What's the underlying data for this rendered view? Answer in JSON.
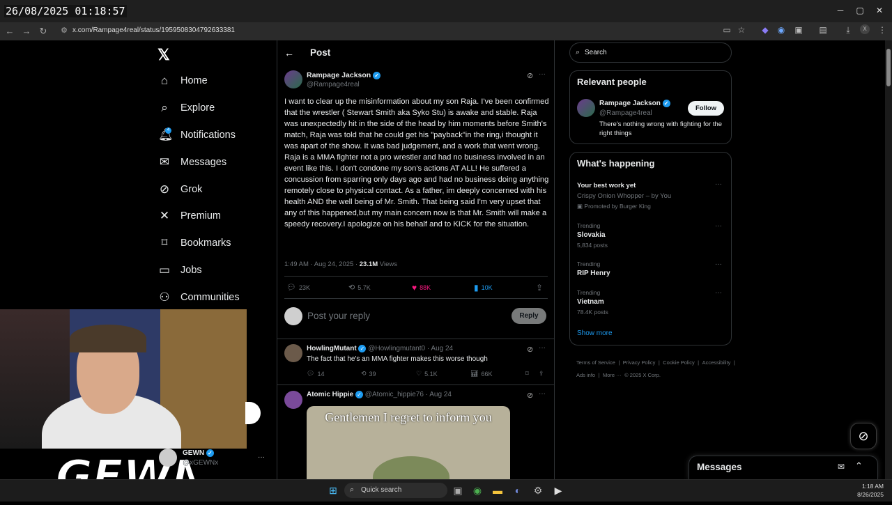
{
  "overlay": {
    "timestamp": "26/08/2025 01:18:57"
  },
  "browser": {
    "url": "x.com/Rampage4real/status/1959508304792633381",
    "window_controls": [
      "─",
      "▢",
      "✕"
    ],
    "profile_initial": "X"
  },
  "sidebar": {
    "logo": "𝕏",
    "items": [
      {
        "label": "Home",
        "icon": "home-icon"
      },
      {
        "label": "Explore",
        "icon": "search-icon"
      },
      {
        "label": "Notifications",
        "icon": "bell-icon"
      },
      {
        "label": "Messages",
        "icon": "envelope-icon"
      },
      {
        "label": "Grok",
        "icon": "grok-icon"
      },
      {
        "label": "Premium",
        "icon": "x-icon"
      },
      {
        "label": "Bookmarks",
        "icon": "bookmark-icon"
      },
      {
        "label": "Jobs",
        "icon": "briefcase-icon"
      },
      {
        "label": "Communities",
        "icon": "people-icon"
      }
    ],
    "notif_badge": "4",
    "account": {
      "name": "GEWN",
      "handle": "@xGEWNx",
      "more": "···"
    }
  },
  "post": {
    "header_title": "Post",
    "author_name": "Rampage Jackson",
    "author_handle": "@Rampage4real",
    "text": "I want to clear up the misinformation about my son Raja. I've been confirmed that the wrestler ( Stewart Smith aka Syko Stu) is awake and stable. Raja was unexpectedly hit in the side of the head by him moments before Smith's match, Raja was told that he could get his \"payback\"in the ring,i thought it was apart of the show. It was bad judgement, and a work that went wrong. Raja is a MMA fighter not a pro wrestler and had no business involved in an event like this. I don't condone my son's actions AT ALL! He suffered a concussion from sparring only days ago and had no business doing anything remotely close to physical contact. As a father, im deeply concerned with his health AND the well being of Mr. Smith. That being said I'm very upset that any of this happened,but my main concern now is that Mr. Smith will make a speedy recovery.I apologize on his behalf and to KICK for the situation.",
    "time": "1:49 AM · Aug 24, 2025 · ",
    "views_count": "23.1M",
    "views_label": " Views",
    "replies": "23K",
    "reposts": "5.7K",
    "likes": "88K",
    "bookmarks": "10K"
  },
  "compose": {
    "placeholder": "Post your reply",
    "button": "Reply"
  },
  "replies": [
    {
      "name": "HowlingMutant",
      "handle": "@Howlingmutant0",
      "date": "· Aug 24",
      "text": "The fact that he's an MMA fighter makes this worse though",
      "replies": "14",
      "reposts": "39",
      "likes": "5.1K",
      "views": "66K"
    },
    {
      "name": "Atomic Hippie",
      "handle": "@Atomic_hippie76",
      "date": "· Aug 24",
      "meme_caption": "Gentlemen I regret to inform you"
    }
  ],
  "right": {
    "search_placeholder": "Search",
    "relevant_title": "Relevant people",
    "person": {
      "name": "Rampage Jackson",
      "handle": "@Rampage4real",
      "bio": "There's nothing wrong with fighting for the right things",
      "follow": "Follow"
    },
    "happening_title": "What's happening",
    "promo": {
      "title": "Your best work yet",
      "subtitle": "Crispy Onion Whopper – by You",
      "promoted": "Promoted by Burger King"
    },
    "trends": [
      {
        "label": "Trending",
        "title": "Slovakia",
        "count": "5,834 posts"
      },
      {
        "label": "Trending",
        "title": "RIP Henry",
        "count": ""
      },
      {
        "label": "Trending",
        "title": "Vietnam",
        "count": "78.4K posts"
      }
    ],
    "show_more": "Show more",
    "footer": [
      "Terms of Service",
      "|",
      "Privacy Policy",
      "|",
      "Cookie Policy",
      "|",
      "Accessibility",
      "|",
      "Ads info",
      "|",
      "More ···",
      "© 2025 X Corp."
    ]
  },
  "messages_drawer": {
    "title": "Messages"
  },
  "taskbar": {
    "search": "Quick search",
    "time": "1:18 AM",
    "date": "8/26/2025"
  },
  "colors": {
    "accent": "#1d9bf0",
    "like": "#f91880",
    "background": "#000000",
    "border": "#2f3336",
    "muted": "#71767b"
  }
}
